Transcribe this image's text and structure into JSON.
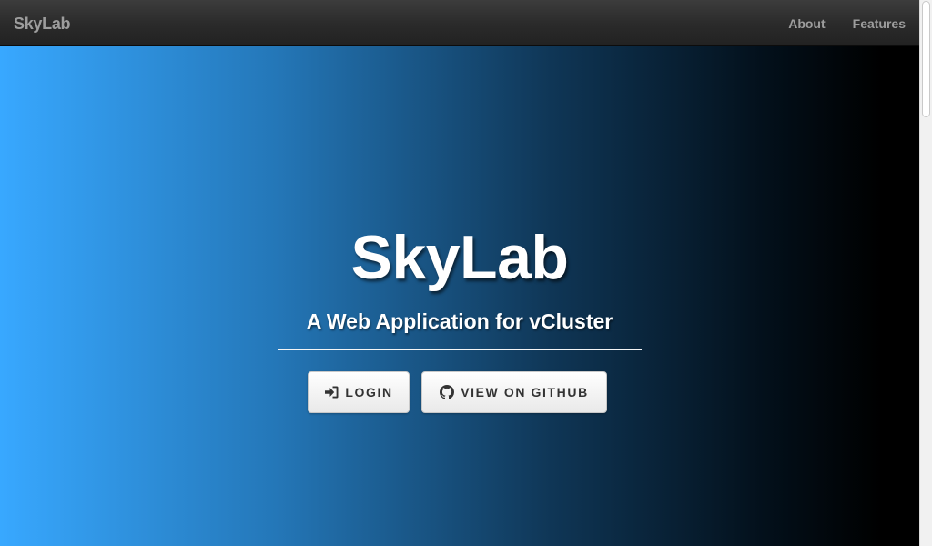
{
  "navbar": {
    "brand": "SkyLab",
    "links": [
      {
        "label": "About"
      },
      {
        "label": "Features"
      }
    ]
  },
  "hero": {
    "title": "SkyLab",
    "subtitle": "A Web Application for vCluster",
    "buttons": {
      "login": {
        "label": "LOGIN",
        "icon": "sign-in-icon"
      },
      "github": {
        "label": "VIEW ON GITHUB",
        "icon": "github-icon"
      }
    }
  },
  "colors": {
    "navbar": "#2a2a2a",
    "nav_text": "#9d9d9d",
    "hero_start": "#38a8ff",
    "hero_end": "#000000",
    "button_text": "#333333"
  }
}
